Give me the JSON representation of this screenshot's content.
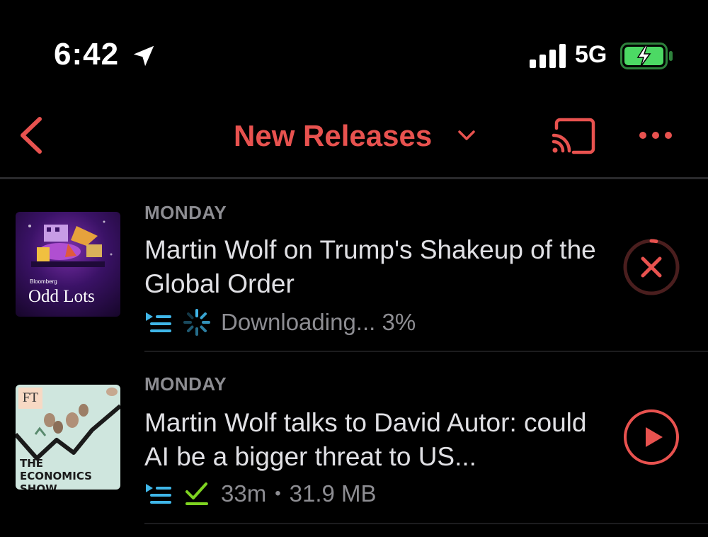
{
  "status_bar": {
    "time": "6:42",
    "network": "5G"
  },
  "header": {
    "title": "New Releases"
  },
  "episodes": [
    {
      "artwork_brand": "Bloomberg",
      "artwork_title": "Odd Lots",
      "day": "MONDAY",
      "title": "Martin Wolf on Trump's Shakeup of the Global Order",
      "status": "Downloading... 3%",
      "download_progress": 0.03,
      "action_icon": "cancel-download-icon"
    },
    {
      "artwork_brand": "FT",
      "artwork_title": "THE ECONOMICS SHOW",
      "day": "MONDAY",
      "title": "Martin Wolf talks to David Autor: could AI be a bigger threat to US...",
      "duration": "33m",
      "separator": "•",
      "size": "31.9 MB",
      "action_icon": "play-icon"
    }
  ],
  "colors": {
    "accent": "#e8524f",
    "queue_blue": "#3fb6e8",
    "downloaded_green": "#7ed321",
    "battery_green": "#4cd964"
  }
}
